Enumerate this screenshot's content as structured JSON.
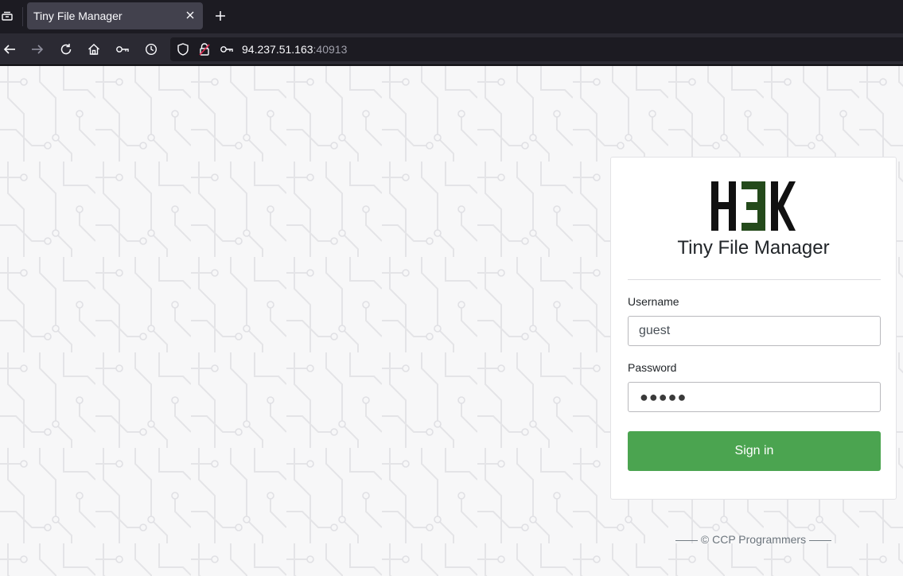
{
  "browser": {
    "tab": {
      "title": "Tiny File Manager"
    },
    "url": {
      "host": "94.237.51.163",
      "port": ":40913"
    }
  },
  "login": {
    "logo_text": "H3K",
    "app_title": "Tiny File Manager",
    "username_label": "Username",
    "username_value": "guest",
    "password_label": "Password",
    "password_mask": "●●●●●",
    "signin_label": "Sign in"
  },
  "footer": {
    "text": "—— © CCP Programmers ——"
  },
  "colors": {
    "accent_green": "#4ba450",
    "logo_dark": "#111111",
    "logo_green": "#244a1b",
    "browser_chrome": "#1c1b22"
  },
  "icons": {
    "tab_overview": "tab-overview-icon",
    "tab_close": "close-icon",
    "new_tab": "plus-icon",
    "back": "back-arrow-icon",
    "forward": "forward-arrow-icon",
    "reload": "reload-icon",
    "home": "home-icon",
    "key": "key-icon",
    "history": "clock-icon",
    "shield": "shield-icon",
    "insecure_lock": "insecure-lock-icon"
  }
}
